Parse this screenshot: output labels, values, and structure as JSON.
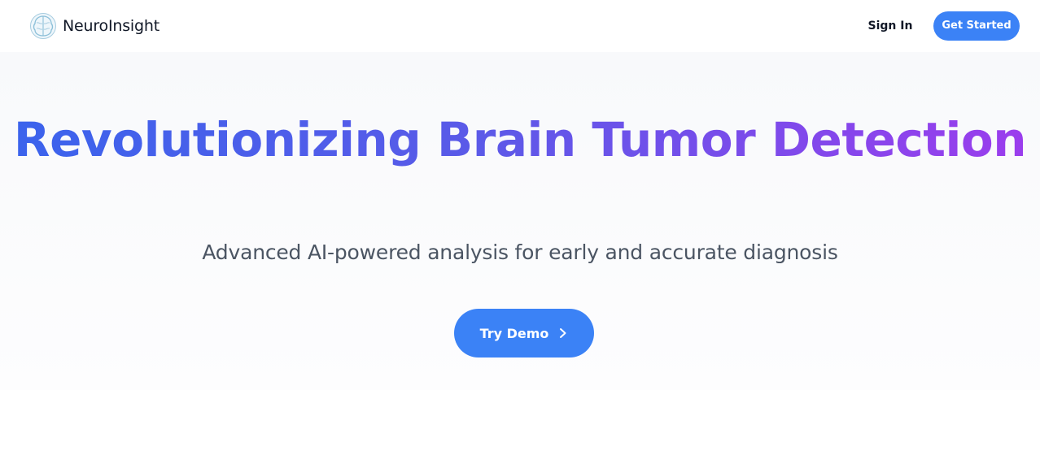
{
  "brand": {
    "name": "NeuroInsight",
    "icon": "brain-icon"
  },
  "nav": {
    "signin_label": "Sign In",
    "get_started_label": "Get Started"
  },
  "hero": {
    "headline": "Revolutionizing Brain Tumor Detection",
    "subtitle": "Advanced AI-powered analysis for early and accurate diagnosis",
    "cta_label": "Try Demo",
    "cta_icon": "chevron-right-icon"
  },
  "colors": {
    "accent": "#3b82f6",
    "headline_gradient_start": "#3b63ec",
    "headline_gradient_end": "#9b3ded",
    "hero_background": "#f8f9fb",
    "text_dark": "#111827",
    "text_muted": "#4b5563"
  }
}
